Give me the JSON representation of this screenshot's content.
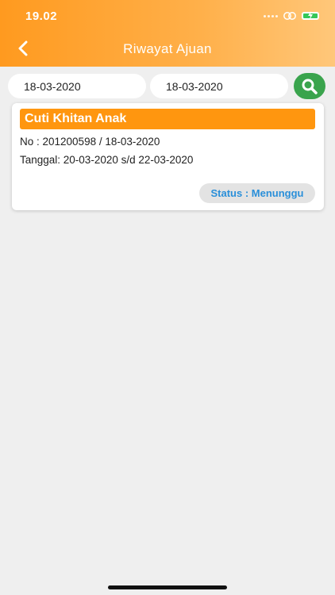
{
  "status_bar": {
    "time": "19.02"
  },
  "header": {
    "title": "Riwayat Ajuan",
    "back_icon": "chevron-left-icon"
  },
  "filter": {
    "date_from": "18-03-2020",
    "date_to": "18-03-2020",
    "search_icon": "search-icon"
  },
  "colors": {
    "header_start": "#ff9a1f",
    "header_end": "#ffc77a",
    "title_bar": "#ff960f",
    "search_button": "#3aa44d",
    "status_text": "#2a8fd9"
  },
  "requests": [
    {
      "type": "Cuti Khitan Anak",
      "no_line": "No : 201200598 / 18-03-2020",
      "date_line": "Tanggal: 20-03-2020 s/d 22-03-2020",
      "status": "Status : Menunggu"
    }
  ]
}
